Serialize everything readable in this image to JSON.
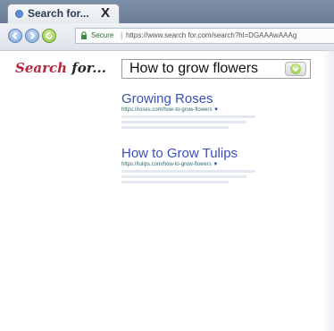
{
  "browser": {
    "tab": {
      "title": "Search for...",
      "close_glyph": "X"
    },
    "address": {
      "secure_label": "Secure",
      "url": "https://www.search for.com/search?hl=DGAAAwAAAg"
    }
  },
  "page": {
    "logo": {
      "part1": "Search",
      "part2": " for..."
    },
    "search": {
      "query": "How to grow flowers"
    },
    "results": [
      {
        "title": "Growing Roses",
        "url": "https://roses.com/how-to-grow-flowers"
      },
      {
        "title": "How to Grow Tulips",
        "url": "https://tulips.com/how-to-grow-flowers"
      }
    ]
  },
  "colors": {
    "logo_red": "#b7273a",
    "link_blue": "#3a50b8",
    "url_green": "#2e6b6b"
  },
  "icons": [
    "page-favicon-icon",
    "back-arrow-icon",
    "forward-arrow-icon",
    "reload-icon",
    "lock-icon",
    "search-go-icon"
  ]
}
